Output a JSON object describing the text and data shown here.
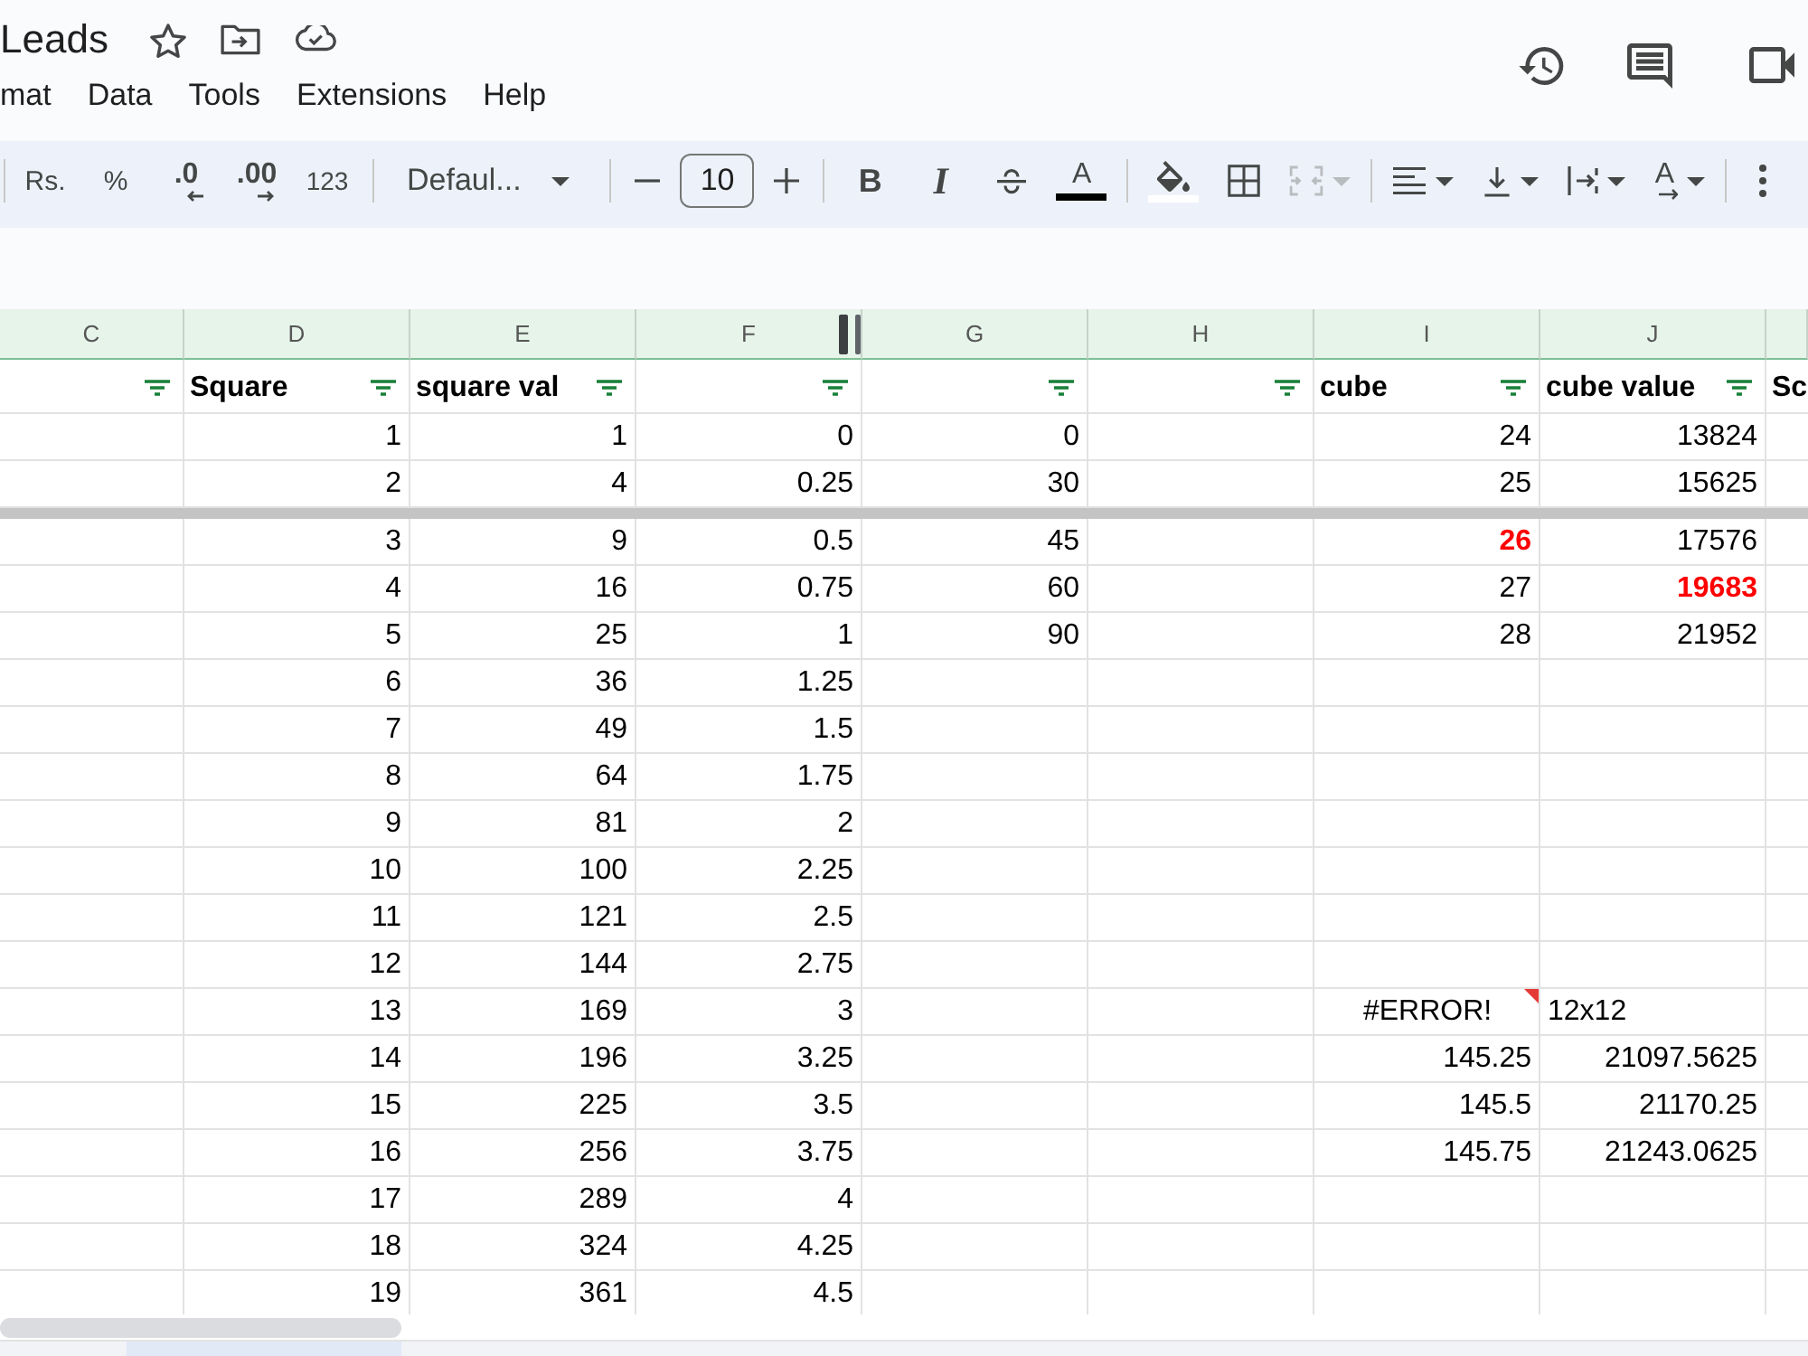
{
  "document": {
    "title": "Leads"
  },
  "menu": [
    "mat",
    "Data",
    "Tools",
    "Extensions",
    "Help"
  ],
  "toolbar": [
    [
      {
        "kind": "currency",
        "label": "Rs.",
        "disabled": false
      },
      {
        "kind": "percent",
        "label": "%",
        "disabled": false
      },
      {
        "kind": "decimal_less",
        "label": ".0",
        "disabled": false
      },
      {
        "kind": "decimal_more",
        "label": ".00",
        "disabled": false
      },
      {
        "kind": "number_format",
        "label": "123",
        "disabled": false
      }
    ],
    [
      {
        "kind": "font",
        "label": "Defaul...",
        "disabled": false
      }
    ],
    [
      {
        "kind": "minus",
        "disabled": false
      },
      {
        "kind": "size",
        "value": "10",
        "disabled": false
      },
      {
        "kind": "plus",
        "disabled": false
      }
    ],
    [
      {
        "kind": "bold",
        "label": "B",
        "disabled": false
      },
      {
        "kind": "italic",
        "label": "I",
        "disabled": false
      },
      {
        "kind": "strike",
        "disabled": false
      },
      {
        "kind": "text_color",
        "label": "A",
        "color": "#000000",
        "disabled": false
      }
    ],
    [
      {
        "kind": "fill_color",
        "color": "#ffffff",
        "disabled": false
      },
      {
        "kind": "borders",
        "disabled": false
      },
      {
        "kind": "merge",
        "disabled": true
      }
    ],
    [
      {
        "kind": "h_align",
        "disabled": false
      },
      {
        "kind": "v_align",
        "disabled": false
      },
      {
        "kind": "wrap",
        "disabled": false
      },
      {
        "kind": "rotate",
        "label": "A",
        "disabled": false
      }
    ],
    [
      {
        "kind": "more",
        "disabled": false
      }
    ]
  ],
  "table": {
    "columns": [
      {
        "label": "C",
        "resize_handle": false
      },
      {
        "label": "D",
        "resize_handle": false
      },
      {
        "label": "E",
        "resize_handle": false
      },
      {
        "label": "F",
        "resize_handle": true
      },
      {
        "label": "G",
        "resize_handle": false
      },
      {
        "label": "H",
        "resize_handle": false
      },
      {
        "label": "I",
        "resize_handle": false
      },
      {
        "label": "J",
        "resize_handle": false
      }
    ],
    "header_row": [
      {
        "filter": true
      },
      {
        "text": "Square",
        "filter": true
      },
      {
        "text": "square val",
        "filter": true
      },
      {
        "filter": true
      },
      {
        "filter": true
      },
      {
        "filter": true
      },
      {
        "text": "cube",
        "filter": true
      },
      {
        "text": "cube value",
        "filter": true
      },
      {
        "text": "Sc",
        "filter": false
      }
    ],
    "frozen_rows": [
      [
        null,
        {
          "kind": "number",
          "text": "1"
        },
        {
          "kind": "number",
          "text": "1"
        },
        {
          "kind": "number",
          "text": "0"
        },
        {
          "kind": "number",
          "text": "0"
        },
        null,
        {
          "kind": "number",
          "text": "24"
        },
        {
          "kind": "number",
          "text": "13824"
        }
      ],
      [
        null,
        {
          "kind": "number",
          "text": "2"
        },
        {
          "kind": "number",
          "text": "4"
        },
        {
          "kind": "number",
          "text": "0.25"
        },
        {
          "kind": "number",
          "text": "30"
        },
        null,
        {
          "kind": "number",
          "text": "25"
        },
        {
          "kind": "number",
          "text": "15625"
        }
      ]
    ],
    "rows": [
      [
        null,
        {
          "kind": "number",
          "text": "3"
        },
        {
          "kind": "number",
          "text": "9"
        },
        {
          "kind": "number",
          "text": "0.5"
        },
        {
          "kind": "number",
          "text": "45"
        },
        null,
        {
          "kind": "alert",
          "text": "26"
        },
        {
          "kind": "number",
          "text": "17576"
        }
      ],
      [
        null,
        {
          "kind": "number",
          "text": "4"
        },
        {
          "kind": "number",
          "text": "16"
        },
        {
          "kind": "number",
          "text": "0.75"
        },
        {
          "kind": "number",
          "text": "60"
        },
        null,
        {
          "kind": "number",
          "text": "27"
        },
        {
          "kind": "alert",
          "text": "19683"
        }
      ],
      [
        null,
        {
          "kind": "number",
          "text": "5"
        },
        {
          "kind": "number",
          "text": "25"
        },
        {
          "kind": "number",
          "text": "1"
        },
        {
          "kind": "number",
          "text": "90"
        },
        null,
        {
          "kind": "number",
          "text": "28"
        },
        {
          "kind": "number",
          "text": "21952"
        }
      ],
      [
        null,
        {
          "kind": "number",
          "text": "6"
        },
        {
          "kind": "number",
          "text": "36"
        },
        {
          "kind": "number",
          "text": "1.25"
        }
      ],
      [
        null,
        {
          "kind": "number",
          "text": "7"
        },
        {
          "kind": "number",
          "text": "49"
        },
        {
          "kind": "number",
          "text": "1.5"
        }
      ],
      [
        null,
        {
          "kind": "number",
          "text": "8"
        },
        {
          "kind": "number",
          "text": "64"
        },
        {
          "kind": "number",
          "text": "1.75"
        }
      ],
      [
        null,
        {
          "kind": "number",
          "text": "9"
        },
        {
          "kind": "number",
          "text": "81"
        },
        {
          "kind": "number",
          "text": "2"
        }
      ],
      [
        null,
        {
          "kind": "number",
          "text": "10"
        },
        {
          "kind": "number",
          "text": "100"
        },
        {
          "kind": "number",
          "text": "2.25"
        }
      ],
      [
        null,
        {
          "kind": "number",
          "text": "11"
        },
        {
          "kind": "number",
          "text": "121"
        },
        {
          "kind": "number",
          "text": "2.5"
        }
      ],
      [
        null,
        {
          "kind": "number",
          "text": "12"
        },
        {
          "kind": "number",
          "text": "144"
        },
        {
          "kind": "number",
          "text": "2.75"
        }
      ],
      [
        null,
        {
          "kind": "number",
          "text": "13"
        },
        {
          "kind": "number",
          "text": "169"
        },
        {
          "kind": "number",
          "text": "3"
        },
        null,
        null,
        {
          "kind": "error",
          "text": "#ERROR!"
        },
        {
          "kind": "text",
          "text": "12x12"
        }
      ],
      [
        null,
        {
          "kind": "number",
          "text": "14"
        },
        {
          "kind": "number",
          "text": "196"
        },
        {
          "kind": "number",
          "text": "3.25"
        },
        null,
        null,
        {
          "kind": "number",
          "text": "145.25"
        },
        {
          "kind": "number",
          "text": "21097.5625"
        }
      ],
      [
        null,
        {
          "kind": "number",
          "text": "15"
        },
        {
          "kind": "number",
          "text": "225"
        },
        {
          "kind": "number",
          "text": "3.5"
        },
        null,
        null,
        {
          "kind": "number",
          "text": "145.5"
        },
        {
          "kind": "number",
          "text": "21170.25"
        }
      ],
      [
        null,
        {
          "kind": "number",
          "text": "16"
        },
        {
          "kind": "number",
          "text": "256"
        },
        {
          "kind": "number",
          "text": "3.75"
        },
        null,
        null,
        {
          "kind": "number",
          "text": "145.75"
        },
        {
          "kind": "number",
          "text": "21243.0625"
        }
      ],
      [
        null,
        {
          "kind": "number",
          "text": "17"
        },
        {
          "kind": "number",
          "text": "289"
        },
        {
          "kind": "number",
          "text": "4"
        }
      ],
      [
        null,
        {
          "kind": "number",
          "text": "18"
        },
        {
          "kind": "number",
          "text": "324"
        },
        {
          "kind": "number",
          "text": "4.25"
        }
      ],
      [
        null,
        {
          "kind": "number",
          "text": "19"
        },
        {
          "kind": "number",
          "text": "361"
        },
        {
          "kind": "number",
          "text": "4.5"
        }
      ]
    ]
  }
}
